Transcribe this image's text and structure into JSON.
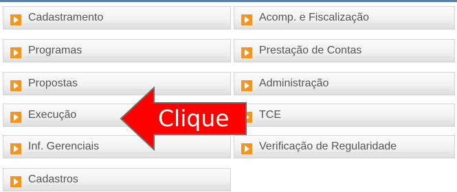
{
  "menu": {
    "left": [
      {
        "label": "Cadastramento"
      },
      {
        "label": "Programas"
      },
      {
        "label": "Propostas"
      },
      {
        "label": "Execução"
      },
      {
        "label": "Inf. Gerenciais"
      },
      {
        "label": "Cadastros"
      }
    ],
    "right": [
      {
        "label": "Acomp. e Fiscalização"
      },
      {
        "label": "Prestação de Contas"
      },
      {
        "label": "Administração"
      },
      {
        "label": "TCE"
      },
      {
        "label": "Verificação de Regularidade"
      }
    ]
  },
  "annotation": {
    "text": "Clique",
    "color": "#ff0000"
  },
  "colors": {
    "icon_orange": "#f7931e",
    "label_gray": "#555555"
  }
}
